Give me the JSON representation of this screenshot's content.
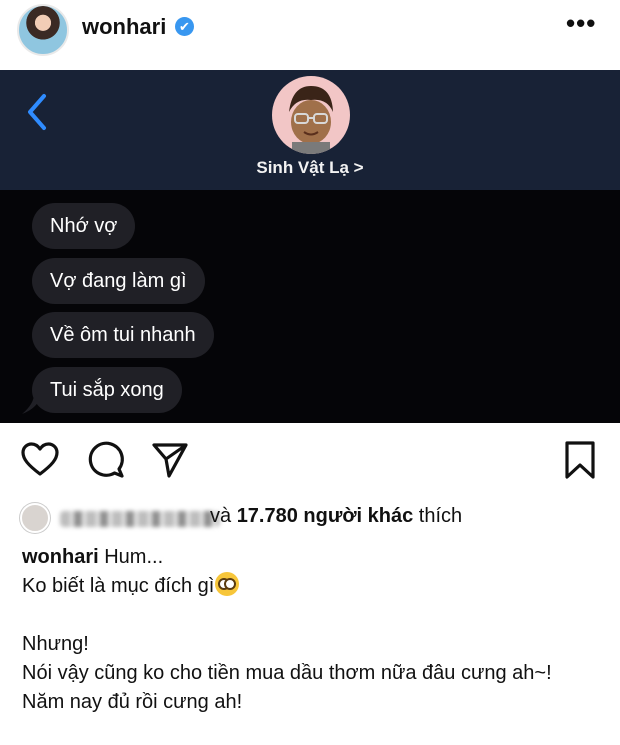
{
  "post": {
    "username": "wonhari",
    "verified_mark": "✔",
    "more_icon": "more-horizontal-icon",
    "more_label": "•••"
  },
  "chat": {
    "contact_name": "Sinh Vật Lạ >",
    "messages": [
      {
        "text": "Nhớ vợ"
      },
      {
        "text": "Vợ đang làm gì"
      },
      {
        "text": "Về ôm tui nhanh"
      },
      {
        "text": "Tui sắp xong"
      }
    ]
  },
  "actions": {
    "like_icon": "heart-icon",
    "comment_icon": "comment-icon",
    "share_icon": "send-icon",
    "save_icon": "bookmark-icon"
  },
  "likes": {
    "prefix": "và ",
    "count_text": "17.780 người khác",
    "suffix": " thích"
  },
  "caption": {
    "username": "wonhari",
    "first_line": " Hum...",
    "line2": "Ko biết là mục đích gì",
    "line3": "Nhưng!",
    "line4": "Nói vậy cũng ko cho tiền mua dầu thơm nữa đâu cưng ah~!",
    "line5": "Năm nay đủ rồi cưng ah!"
  },
  "colors": {
    "chat_header_bg": "#182236",
    "chat_bg": "#050508",
    "bubble_bg": "#202026",
    "back_chevron": "#2f8cff",
    "verified": "#3897f0"
  }
}
